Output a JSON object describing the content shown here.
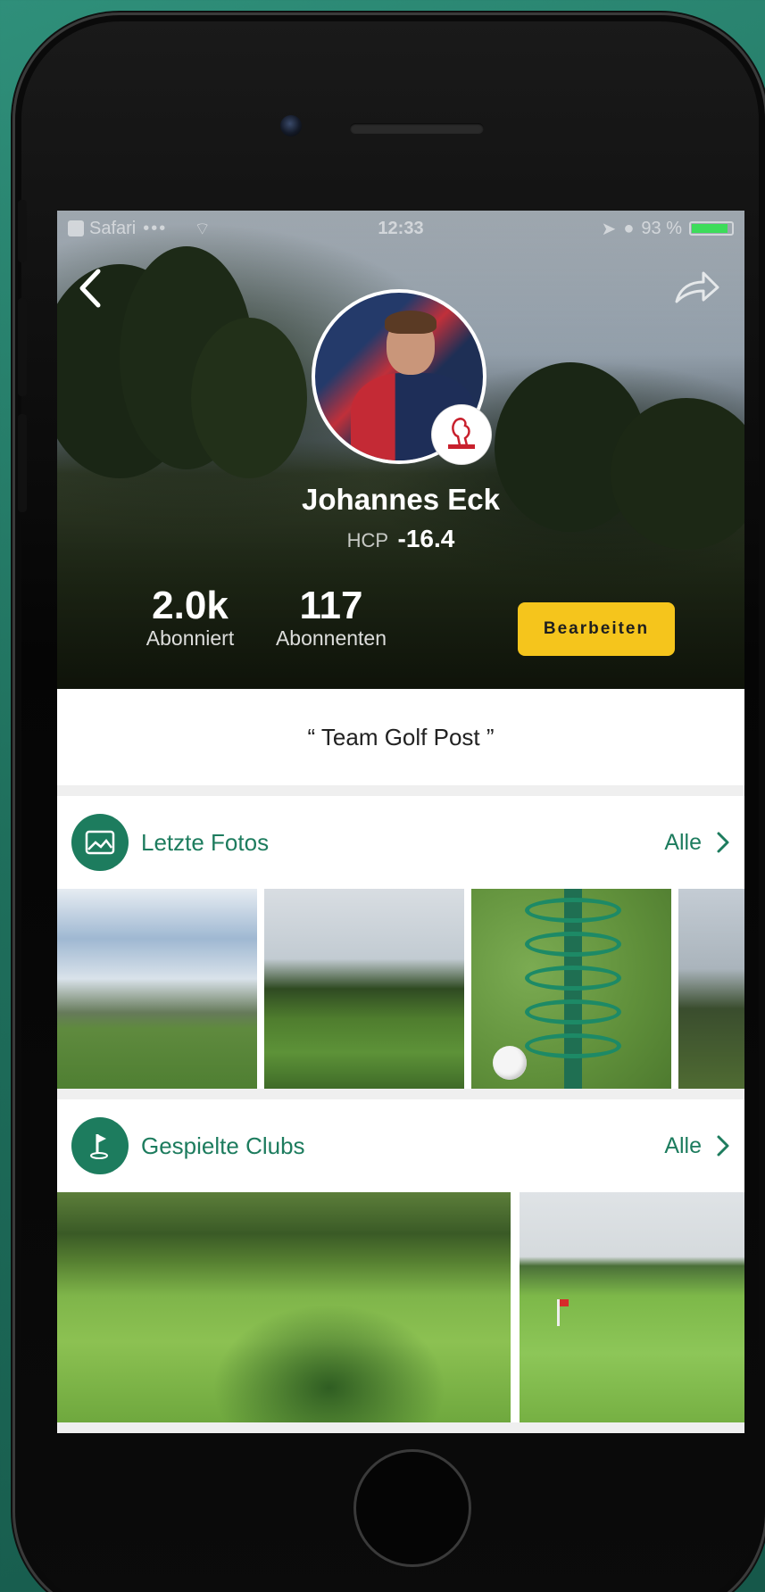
{
  "status_bar": {
    "back_app": "Safari",
    "signal": "•••",
    "time": "12:33",
    "battery": "93 %"
  },
  "profile": {
    "name": "Johannes Eck",
    "hcp_label": "HCP",
    "hcp_value": "-16.4",
    "stats": [
      {
        "value": "2.0k",
        "label": "Abonniert"
      },
      {
        "value": "117",
        "label": "Abonnenten"
      }
    ],
    "edit_label": "Bearbeiten",
    "motto": "“ Team Golf Post ”"
  },
  "sections": {
    "photos": {
      "title": "Letzte Fotos",
      "all_label": "Alle"
    },
    "clubs": {
      "title": "Gespielte Clubs",
      "all_label": "Alle"
    }
  },
  "colors": {
    "accent": "#1d7c5e",
    "button": "#f5c51c",
    "background": "#2f8f7a"
  }
}
